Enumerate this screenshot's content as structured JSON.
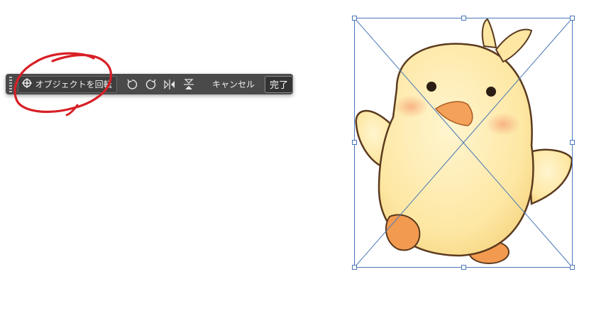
{
  "toolbar": {
    "rotate_object_label": "オブジェクトを回転",
    "cancel_label": "キャンセル",
    "done_label": "完了",
    "icons": [
      "rotate-object-icon",
      "rotate-left-icon",
      "rotate-right-icon",
      "flip-horizontal-icon",
      "flip-vertical-icon"
    ]
  },
  "colors": {
    "toolbar_bg": "#4a4a4a",
    "annotation": "#d81f26",
    "selection": "#4a78b8",
    "chick_body": "#fde9a8",
    "chick_beak": "#f4a259"
  }
}
